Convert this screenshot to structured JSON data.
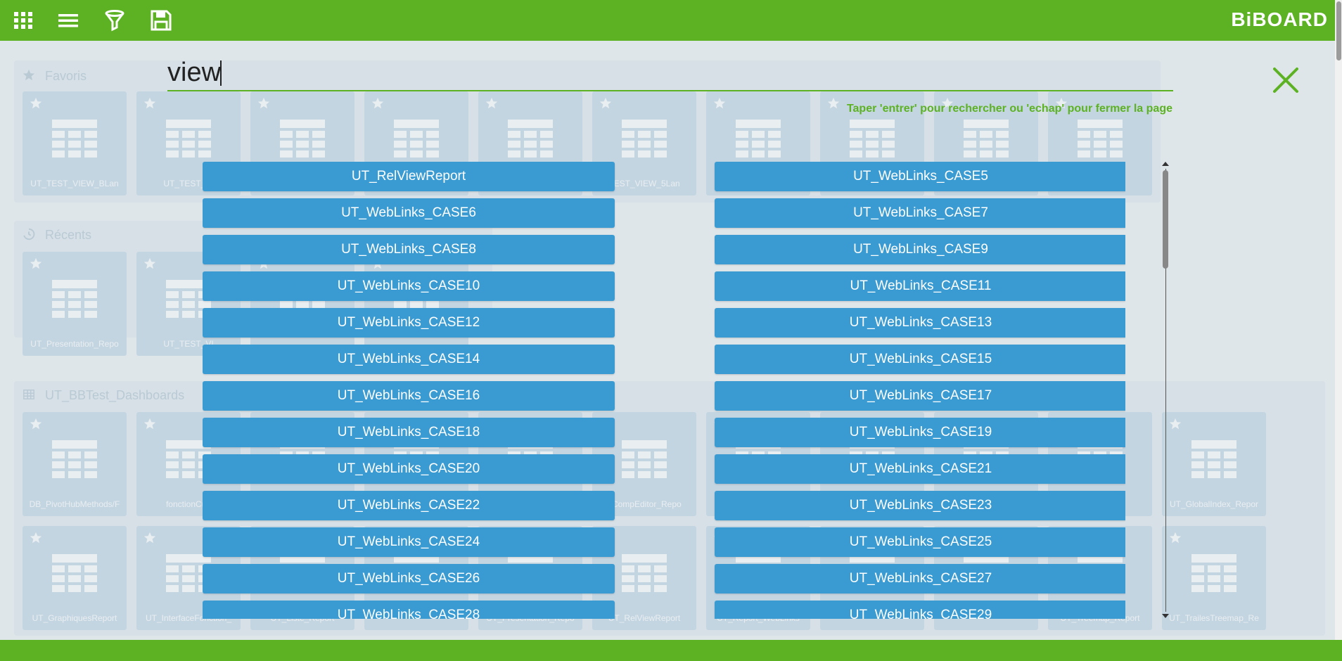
{
  "topbar": {
    "icons": [
      "apps-grid-icon",
      "menu-icon",
      "filter-icon",
      "save-icon"
    ],
    "logo": "BiBOARD"
  },
  "colors": {
    "brand_green": "#5cb223",
    "result_blue": "#3a9bd2"
  },
  "background": {
    "favorites": {
      "title": "Favoris",
      "tiles": [
        "UT_TEST_VIEW_BLan",
        "UT_TEST_VI",
        "",
        "",
        "",
        "TEST_VIEW_5Lan",
        "",
        "",
        "",
        "5Lan"
      ]
    },
    "recents": {
      "title": "Récents",
      "tiles": [
        "UT_Presentation_Repo",
        "UT_TEST_VI",
        "",
        ""
      ]
    },
    "dashboards": {
      "title": "UT_BBTest_Dashboards",
      "row1": [
        "DB_PivotHubMethods/F",
        "fonctionCub",
        "",
        "",
        "",
        "_CompEditor_Repo",
        "",
        "",
        "",
        "omat",
        "UT_GlobalIndex_Repor"
      ],
      "row2": [
        "UT_GraphiquesReport",
        "UT_InterfaceFonction_",
        "UT_Liste_Report",
        "",
        "UT_Presentation_Repo",
        "UT_RelViewReport",
        "UT_Report_WebLinks",
        "",
        "",
        "UT_Treemap_Report",
        "UT_TrailesTreemap_Re"
      ]
    }
  },
  "search": {
    "value": "view",
    "hint": "Taper 'entrer' pour rechercher ou 'echap' pour fermer la page"
  },
  "results": [
    "UT_RelViewReport",
    "UT_WebLinks_CASE5",
    "UT_WebLinks_CASE6",
    "UT_WebLinks_CASE7",
    "UT_WebLinks_CASE8",
    "UT_WebLinks_CASE9",
    "UT_WebLinks_CASE10",
    "UT_WebLinks_CASE11",
    "UT_WebLinks_CASE12",
    "UT_WebLinks_CASE13",
    "UT_WebLinks_CASE14",
    "UT_WebLinks_CASE15",
    "UT_WebLinks_CASE16",
    "UT_WebLinks_CASE17",
    "UT_WebLinks_CASE18",
    "UT_WebLinks_CASE19",
    "UT_WebLinks_CASE20",
    "UT_WebLinks_CASE21",
    "UT_WebLinks_CASE22",
    "UT_WebLinks_CASE23",
    "UT_WebLinks_CASE24",
    "UT_WebLinks_CASE25",
    "UT_WebLinks_CASE26",
    "UT_WebLinks_CASE27",
    "UT_WebLinks_CASE28",
    "UT_WebLinks_CASE29"
  ]
}
